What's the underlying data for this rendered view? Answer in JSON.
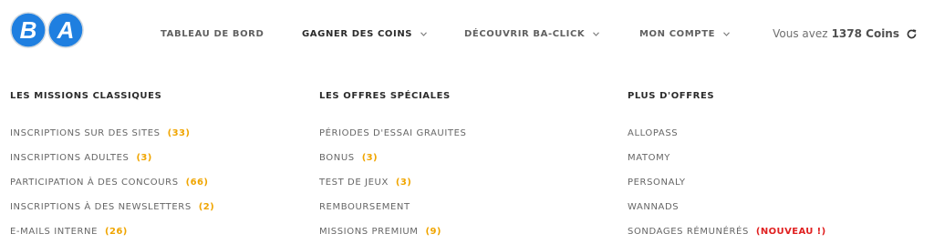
{
  "brand": {
    "logo_text_1": "B",
    "logo_text_2": "A",
    "logo_color": "#1f7fe0"
  },
  "nav": {
    "items": [
      {
        "label": "TABLEAU DE BORD",
        "dropdown": false,
        "active": false
      },
      {
        "label": "GAGNER DES COINS",
        "dropdown": true,
        "active": true
      },
      {
        "label": "DÉCOUVRIR BA-CLICK",
        "dropdown": true,
        "active": false
      },
      {
        "label": "MON COMPTE",
        "dropdown": true,
        "active": false
      }
    ],
    "chevron_icon": "chevron-down-icon"
  },
  "account": {
    "coins_prefix": "Vous avez",
    "coins_value": "1378 Coins",
    "refresh_icon": "refresh-icon"
  },
  "menu": {
    "columns": [
      {
        "title": "LES MISSIONS CLASSIQUES",
        "items": [
          {
            "label": "INSCRIPTIONS SUR DES SITES",
            "count": "(33)"
          },
          {
            "label": "INSCRIPTIONS ADULTES",
            "count": "(3)"
          },
          {
            "label": "PARTICIPATION À DES CONCOURS",
            "count": "(66)"
          },
          {
            "label": "INSCRIPTIONS À DES NEWSLETTERS",
            "count": "(2)"
          },
          {
            "label": "E-MAILS INTERNE",
            "count": "(26)"
          }
        ]
      },
      {
        "title": "LES OFFRES SPÉCIALES",
        "items": [
          {
            "label": "PÉRIODES D'ESSAI GRAUITES"
          },
          {
            "label": "BONUS",
            "count": "(3)"
          },
          {
            "label": "TEST DE JEUX",
            "count": "(3)"
          },
          {
            "label": "REMBOURSEMENT"
          },
          {
            "label": "MISSIONS PREMIUM",
            "count": "(9)"
          }
        ]
      },
      {
        "title": "PLUS D'OFFRES",
        "items": [
          {
            "label": "ALLOPASS"
          },
          {
            "label": "MATOMY"
          },
          {
            "label": "PERSONALY"
          },
          {
            "label": "WANNADS"
          },
          {
            "label": "SONDAGES RÉMUNÉRÉS",
            "badge": "(NOUVEAU !)"
          }
        ]
      }
    ]
  },
  "colors": {
    "count": "#f0a500",
    "new_badge": "#e02020",
    "text": "#666666",
    "heading": "#2b2b2b"
  }
}
